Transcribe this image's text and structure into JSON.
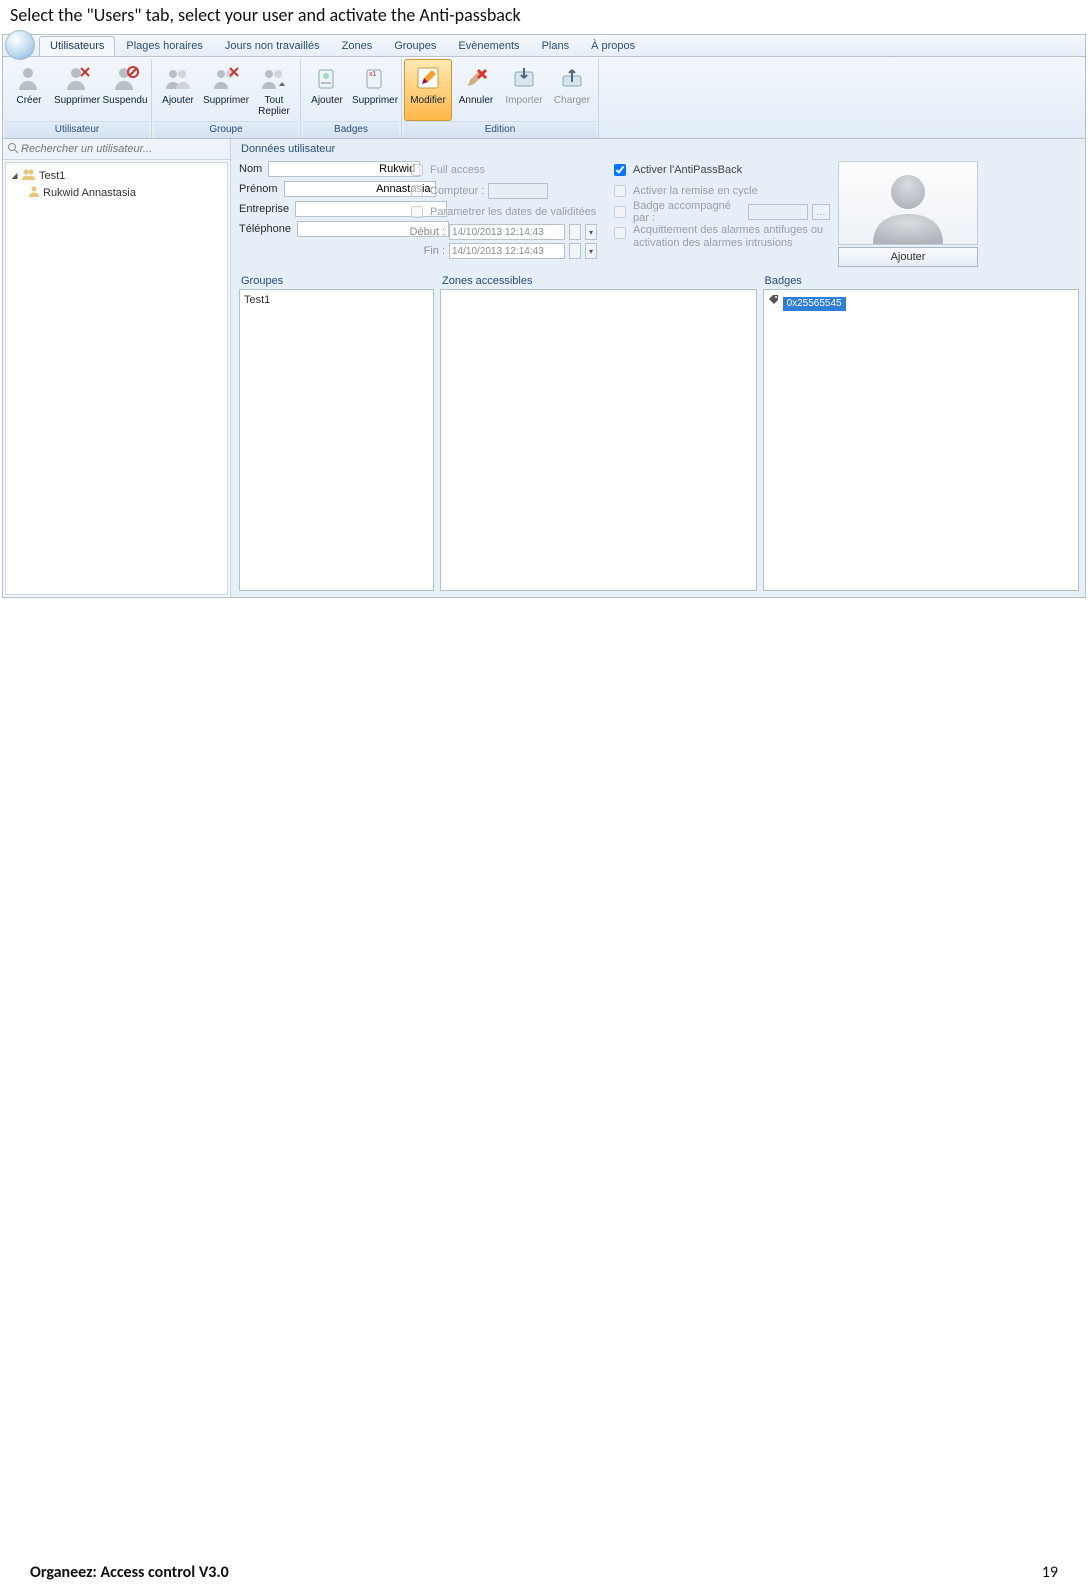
{
  "instruction": "Select the \"Users\" tab, select your user and activate the Anti-passback",
  "tabs": [
    {
      "label": "Utilisateurs",
      "active": true
    },
    {
      "label": "Plages horaires"
    },
    {
      "label": "Jours non travaillés"
    },
    {
      "label": "Zones"
    },
    {
      "label": "Groupes"
    },
    {
      "label": "Evènements"
    },
    {
      "label": "Plans"
    },
    {
      "label": "À propos"
    }
  ],
  "ribbon": {
    "user": {
      "label": "Utilisateur",
      "creer": "Créer",
      "supprimer": "Supprimer",
      "suspendu": "Suspendu"
    },
    "group": {
      "label": "Groupe",
      "ajouter": "Ajouter",
      "supprimer": "Supprimer",
      "tout_replier": "Tout\nReplier"
    },
    "badges": {
      "label": "Badges",
      "ajouter": "Ajouter",
      "supprimer": "Supprimer"
    },
    "edition": {
      "label": "Edition",
      "modifier": "Modifier",
      "annuler": "Annuler",
      "importer": "Importer",
      "charger": "Charger"
    }
  },
  "search_placeholder": "Rechercher un utilisateur...",
  "tree": {
    "root": "Test1",
    "child": "Rukwid Annastasia"
  },
  "form": {
    "title": "Données utilisateur",
    "nom_label": "Nom",
    "nom": "Rukwid",
    "prenom_label": "Prénom",
    "prenom": "Annastasia",
    "entreprise_label": "Entreprise",
    "entreprise": "",
    "telephone_label": "Téléphone",
    "telephone": "",
    "full_access": "Full access",
    "compteur": "Compteur :",
    "param_dates": "Parametrer les dates de validitées",
    "debut_label": "Début :",
    "debut": "14/10/2013 12:14:43",
    "fin_label": "Fin :",
    "fin": "14/10/2013 12:14:43",
    "antipassback": "Activer l'AntiPassBack",
    "remise_cycle": "Activer la remise en cycle",
    "badge_accomp": "Badge accompagné par :",
    "acquittement": "Acquittement des alarmes antifuges ou activation des alarmes intrusions",
    "ajouter_btn": "Ajouter"
  },
  "lists": {
    "groupes_label": "Groupes",
    "groupes_item": "Test1",
    "zones_label": "Zones accessibles",
    "badges_label": "Badges",
    "badge_value": "0x25565545"
  },
  "footer": {
    "left": "Organeez: Access control     V3.0",
    "page": "19"
  }
}
